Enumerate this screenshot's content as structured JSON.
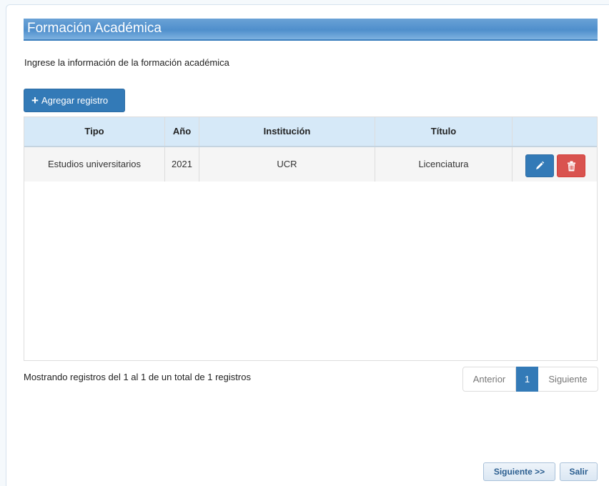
{
  "section": {
    "title": "Formación Académica"
  },
  "intro_text": "Ingrese la información de la formación académica",
  "toolbar": {
    "add_label": "Agregar registro",
    "add_icon": "plus-icon"
  },
  "table": {
    "columns": [
      "Tipo",
      "Año",
      "Institución",
      "Título",
      ""
    ],
    "rows": [
      {
        "tipo": "Estudios universitarios",
        "anio": "2021",
        "institucion": "UCR",
        "titulo": "Licenciatura"
      }
    ],
    "actions": {
      "edit_icon": "pencil-icon",
      "delete_icon": "trash-icon"
    }
  },
  "summary": "Mostrando registros del 1 al 1 de un total de 1 registros",
  "pagination": {
    "previous": "Anterior",
    "current": "1",
    "next": "Siguiente"
  },
  "footer": {
    "next_label": "Siguiente >>",
    "exit_label": "Salir"
  },
  "colors": {
    "primary": "#337ab7",
    "danger": "#d9534f",
    "header_bg": "#d6e9f8"
  }
}
